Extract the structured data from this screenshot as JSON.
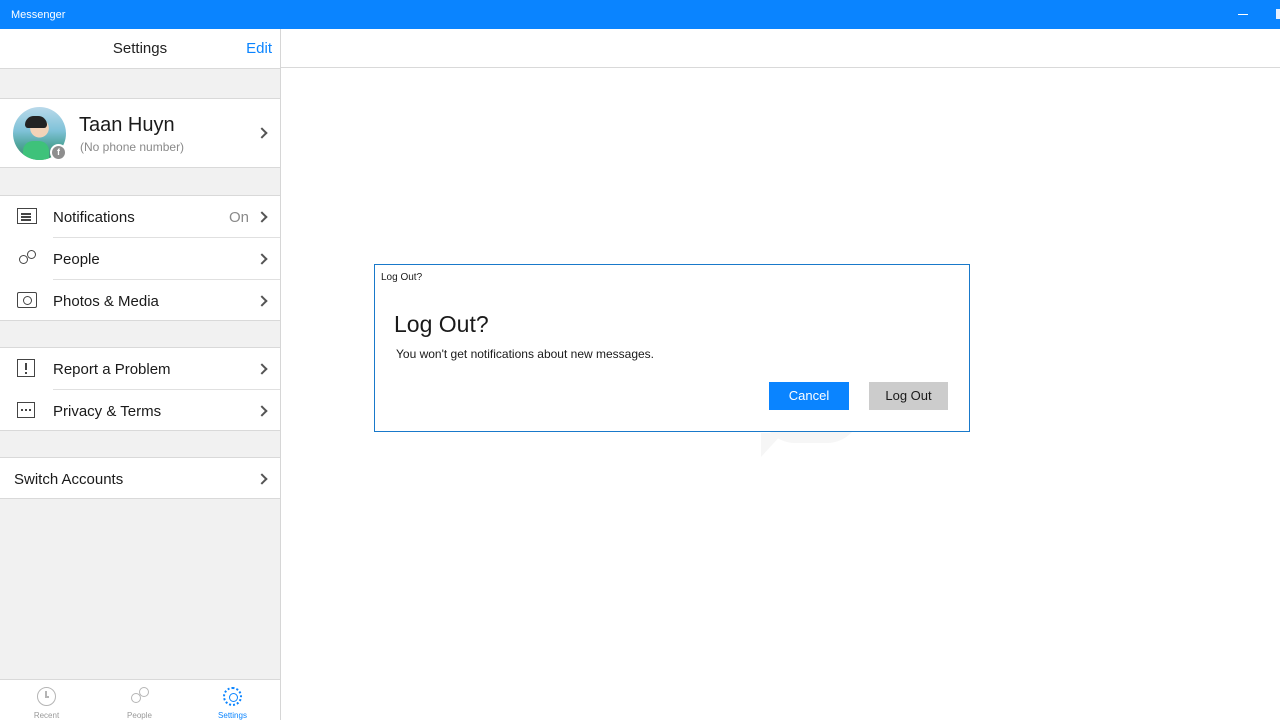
{
  "window": {
    "title": "Messenger"
  },
  "sidebar": {
    "header_title": "Settings",
    "edit_label": "Edit",
    "profile": {
      "name": "Taan Huyn",
      "phone": "(No phone number)"
    },
    "group1": [
      {
        "label": "Notifications",
        "value": "On",
        "icon": "notifications-icon"
      },
      {
        "label": "People",
        "icon": "people-icon"
      },
      {
        "label": "Photos & Media",
        "icon": "camera-icon"
      }
    ],
    "group2": [
      {
        "label": "Report a Problem",
        "icon": "report-icon"
      },
      {
        "label": "Privacy & Terms",
        "icon": "privacy-icon"
      }
    ],
    "group3": [
      {
        "label": "Switch Accounts"
      }
    ]
  },
  "tabs": [
    {
      "label": "Recent",
      "icon": "clock-icon",
      "active": false
    },
    {
      "label": "People",
      "icon": "people-icon",
      "active": false
    },
    {
      "label": "Settings",
      "icon": "gear-icon",
      "active": true
    }
  ],
  "dialog": {
    "caption": "Log Out?",
    "title": "Log Out?",
    "message": "You won't get notifications about new messages.",
    "cancel_label": "Cancel",
    "logout_label": "Log Out"
  },
  "colors": {
    "accent": "#0a84ff",
    "titlebar": "#0a84ff",
    "sidebar_bg": "#f1f1f1",
    "secondary_button": "#cccccc"
  }
}
